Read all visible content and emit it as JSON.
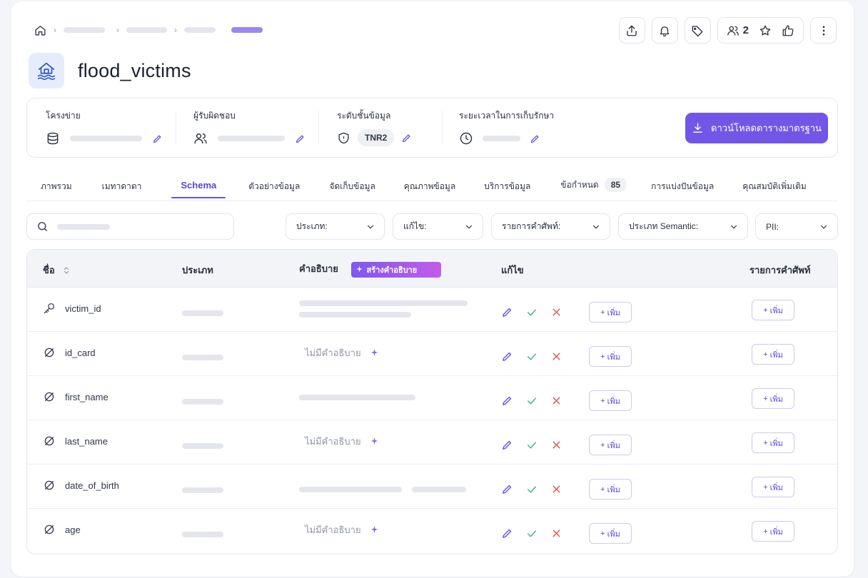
{
  "page": {
    "title": "flood_victims"
  },
  "header_actions": {
    "followers_count": "2"
  },
  "meta": {
    "network_label": "โครงข่าย",
    "owner_label": "ผู้รับผิดชอบ",
    "tier_label": "ระดับชั้นข้อมูล",
    "tier_value": "TNR2",
    "retention_label": "ระยะเวลาในการเก็บรักษา",
    "download_label": "ดาวน์โหลดตารางมาตรฐาน"
  },
  "tabs": [
    {
      "label": "ภาพรวม"
    },
    {
      "label": "เมทาดาตา"
    },
    {
      "label": "Schema",
      "active": true
    },
    {
      "label": "ตัวอย่างข้อมูล"
    },
    {
      "label": "จัดเก็บข้อมูล"
    },
    {
      "label": "คุณภาพข้อมูล"
    },
    {
      "label": "บริการข้อมูล"
    },
    {
      "label": "ข้อกำหนด",
      "count": "85"
    },
    {
      "label": "การแบ่งปันข้อมูล"
    },
    {
      "label": "คุณสมบัติเพิ่มเติม"
    }
  ],
  "filters": {
    "type": "ประเภท:",
    "edit": "แก้ไข:",
    "glossary": "รายการคำศัพท์:",
    "semantic": "ประเภท Semantic:",
    "pii": "PII:"
  },
  "table": {
    "headers": {
      "name": "ชื่อ",
      "type": "ประเภท",
      "description": "คำอธิบาย",
      "generate": "สร้างคำอธิบาย",
      "edit": "แก้ไข",
      "glossary": "รายการคำศัพท์"
    },
    "no_description": "ไม่มีคำอธิบาย",
    "add_label": "เพิ่ม",
    "rows": [
      {
        "name": "victim_id",
        "icon": "key-icon"
      },
      {
        "name": "id_card",
        "icon": "null-icon"
      },
      {
        "name": "first_name",
        "icon": "null-icon"
      },
      {
        "name": "last_name",
        "icon": "null-icon"
      },
      {
        "name": "date_of_birth",
        "icon": "null-icon"
      },
      {
        "name": "age",
        "icon": "null-icon"
      }
    ]
  },
  "colors": {
    "accent": "#7256e8",
    "check": "#3fb884",
    "cross": "#e5534b"
  }
}
